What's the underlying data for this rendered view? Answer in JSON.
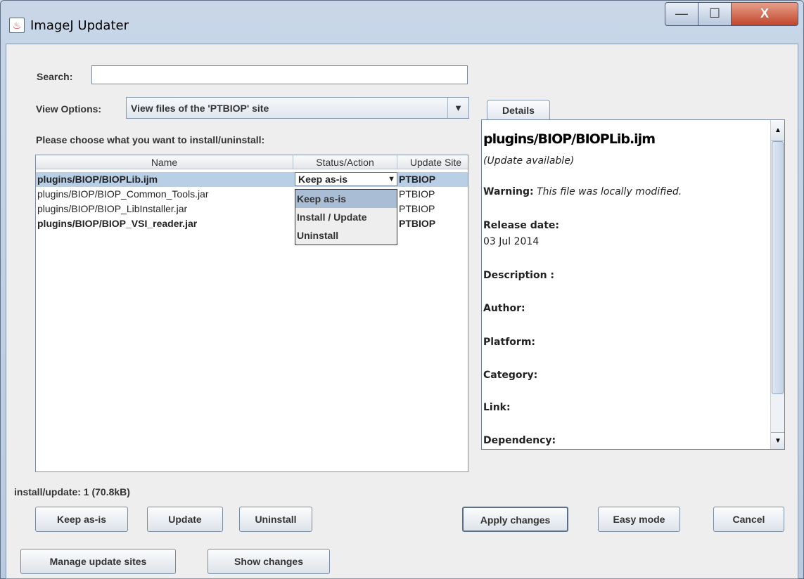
{
  "window": {
    "title": "ImageJ Updater",
    "app_icon": "java-cup-icon",
    "controls": {
      "minimize": "—",
      "maximize": "☐",
      "close": "X"
    }
  },
  "search": {
    "label": "Search:",
    "value": "",
    "placeholder": ""
  },
  "view_options": {
    "label": "View Options:",
    "selected": "View files of the 'PTBIOP' site"
  },
  "instruction": "Please choose what you want to install/uninstall:",
  "table": {
    "columns": [
      "Name",
      "Status/Action",
      "Update Site"
    ],
    "rows": [
      {
        "name": "plugins/BIOP/BIOPLib.ijm",
        "status": "Keep as-is",
        "site": "PTBIOP",
        "bold": true,
        "selected": true
      },
      {
        "name": "plugins/BIOP/BIOP_Common_Tools.jar",
        "status": "",
        "site": "PTBIOP",
        "bold": false,
        "selected": false
      },
      {
        "name": "plugins/BIOP/BIOP_LibInstaller.jar",
        "status": "",
        "site": "PTBIOP",
        "bold": false,
        "selected": false
      },
      {
        "name": "plugins/BIOP/BIOP_VSI_reader.jar",
        "status": "",
        "site": "PTBIOP",
        "bold": true,
        "selected": false
      }
    ],
    "status_options": [
      "Keep as-is",
      "Install / Update",
      "Uninstall"
    ]
  },
  "details": {
    "tab": "Details",
    "file": "plugins/BIOP/BIOPLib.ijm",
    "status": "(Update available)",
    "warning_label": "Warning:",
    "warning_text": "This file was locally modified.",
    "release_label": "Release date:",
    "release_value": "03 Jul 2014",
    "description_label": "Description :",
    "author_label": "Author:",
    "platform_label": "Platform:",
    "category_label": "Category:",
    "link_label": "Link:",
    "dependency_label": "Dependency:"
  },
  "summary": {
    "prefix": "install/update: ",
    "count": "1",
    "size": " (70.8kB)"
  },
  "buttons": {
    "keep": "Keep as-is",
    "update": "Update",
    "uninstall": "Uninstall",
    "apply": "Apply changes",
    "easy": "Easy mode",
    "cancel": "Cancel",
    "manage": "Manage update sites",
    "show": "Show changes"
  }
}
